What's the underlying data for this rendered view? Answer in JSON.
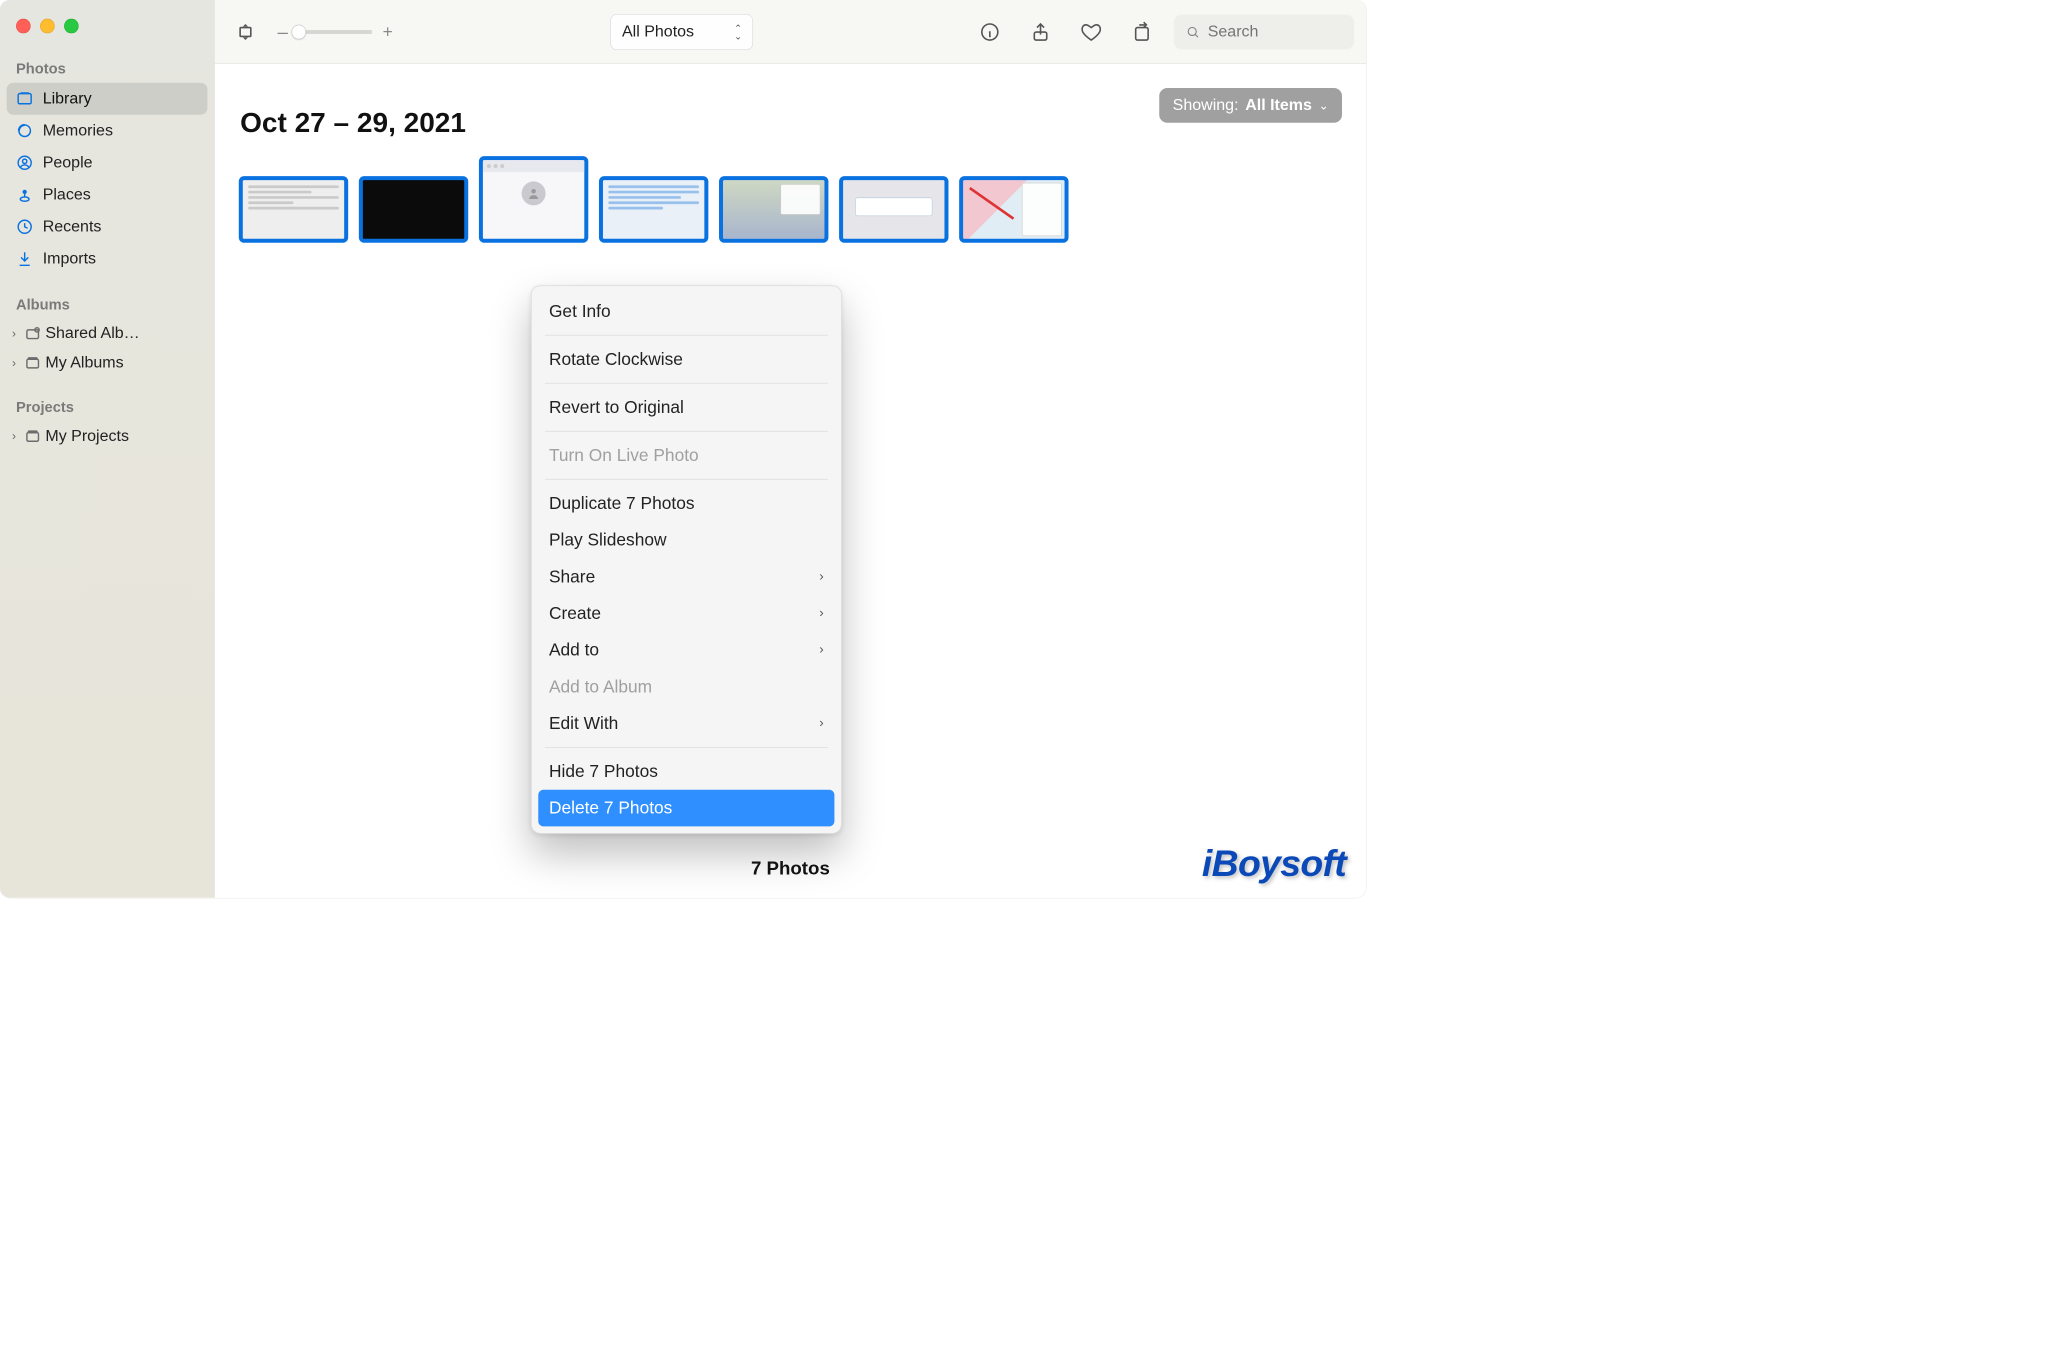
{
  "sidebar": {
    "sections": {
      "photos_title": "Photos",
      "albums_title": "Albums",
      "projects_title": "Projects"
    },
    "items": {
      "library": "Library",
      "memories": "Memories",
      "people": "People",
      "places": "Places",
      "recents": "Recents",
      "imports": "Imports",
      "shared_albums": "Shared Alb…",
      "my_albums": "My Albums",
      "my_projects": "My Projects"
    }
  },
  "toolbar": {
    "zoom_minus": "–",
    "zoom_plus": "+",
    "view_selector": "All Photos",
    "search_placeholder": "Search"
  },
  "showing": {
    "prefix": "Showing:",
    "value": "All Items"
  },
  "content": {
    "date_header": "Oct 27 – 29, 2021",
    "count_label": "7 Photos"
  },
  "context_menu": {
    "get_info": "Get Info",
    "rotate": "Rotate Clockwise",
    "revert": "Revert to Original",
    "live_photo": "Turn On Live Photo",
    "duplicate": "Duplicate 7 Photos",
    "slideshow": "Play Slideshow",
    "share": "Share",
    "create": "Create",
    "add_to": "Add to",
    "add_to_album": "Add to Album",
    "edit_with": "Edit With",
    "hide": "Hide 7 Photos",
    "delete": "Delete 7 Photos"
  },
  "watermark": "iBoysoft"
}
